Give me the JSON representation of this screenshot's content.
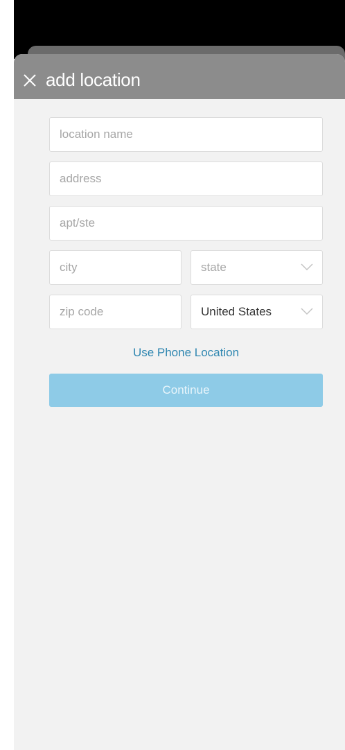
{
  "header": {
    "title": "add location",
    "close_icon": "close-icon"
  },
  "form": {
    "location_name": {
      "placeholder": "location name",
      "value": ""
    },
    "address": {
      "placeholder": "address",
      "value": ""
    },
    "apt": {
      "placeholder": "apt/ste",
      "value": ""
    },
    "city": {
      "placeholder": "city",
      "value": ""
    },
    "state": {
      "selected": "state",
      "icon": "chevron-down-icon"
    },
    "zip": {
      "placeholder": "zip code",
      "value": ""
    },
    "country": {
      "selected": "United States",
      "icon": "chevron-down-icon"
    }
  },
  "actions": {
    "use_phone_location": "Use Phone Location",
    "continue": "Continue"
  },
  "colors": {
    "header_bg": "#8c8c8c",
    "sheet_bg": "#f2f2f2",
    "link": "#2e86b0",
    "button_bg": "#8ecbe7"
  }
}
